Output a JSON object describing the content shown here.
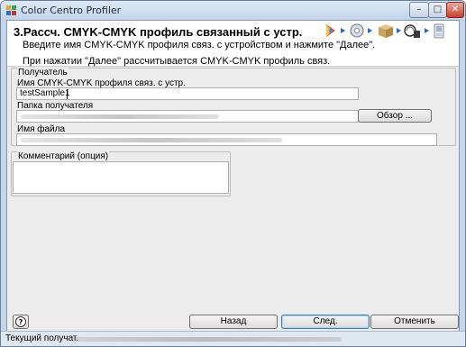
{
  "window": {
    "title": "Color Centro Profiler",
    "controls": {
      "minimize": "–",
      "maximize": "□",
      "close": "✕"
    }
  },
  "header": {
    "step_title": "3.Рассч. CMYK-CMYK профиль связанный с устр.",
    "instruction": "Введите имя CMYK-CMYK профиля связ. с устройством и нажмите \"Далее\".",
    "note": "При нажатии \"Далее\" рассчитывается CMYK-CMYK профиль связ.",
    "step_icons": [
      "color-wheel-icon",
      "disc-icon",
      "package-icon",
      "chart-icon",
      "pda-icon"
    ]
  },
  "recipient": {
    "group_label": "Получатель",
    "profile_name_label": "Имя CMYK-CMYK профиля связ. с устр.",
    "profile_name_value": "testSample1",
    "folder_label": "Папка получателя",
    "browse_label": "Обзор ...",
    "file_name_label": "Имя файла"
  },
  "comment": {
    "group_label": "Комментарий (опция)",
    "value": ""
  },
  "buttons": {
    "help": "?",
    "back": "Назад",
    "next": "След.",
    "cancel": "Отменить"
  },
  "status": {
    "label": "Текущий получат."
  },
  "colors": {
    "frame": "#c6d6e9",
    "panel": "#ececec",
    "accent_arrow": "#2f66c5"
  }
}
